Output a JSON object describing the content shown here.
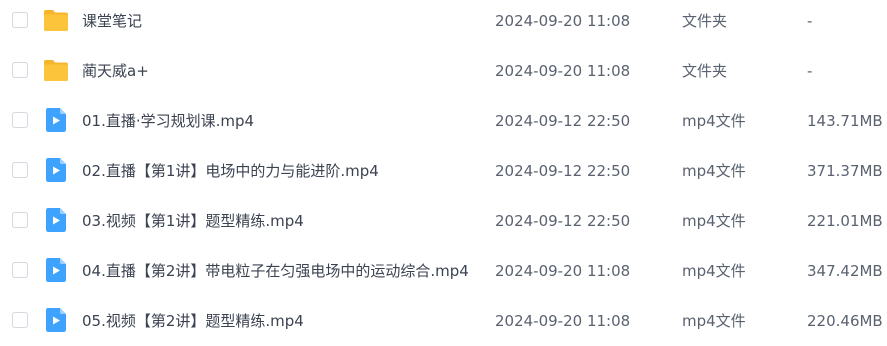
{
  "files": [
    {
      "name": "课堂笔记",
      "modified": "2024-09-20 11:08",
      "type": "文件夹",
      "size": "-",
      "icon": "folder-icon"
    },
    {
      "name": "蔺天威a+",
      "modified": "2024-09-20 11:08",
      "type": "文件夹",
      "size": "-",
      "icon": "folder-icon"
    },
    {
      "name": "01.直播·学习规划课.mp4",
      "modified": "2024-09-12 22:50",
      "type": "mp4文件",
      "size": "143.71MB",
      "icon": "video-file-icon"
    },
    {
      "name": "02.直播【第1讲】电场中的力与能进阶.mp4",
      "modified": "2024-09-12 22:50",
      "type": "mp4文件",
      "size": "371.37MB",
      "icon": "video-file-icon"
    },
    {
      "name": "03.视频【第1讲】题型精练.mp4",
      "modified": "2024-09-12 22:50",
      "type": "mp4文件",
      "size": "221.01MB",
      "icon": "video-file-icon"
    },
    {
      "name": "04.直播【第2讲】带电粒子在匀强电场中的运动综合.mp4",
      "modified": "2024-09-20 11:08",
      "type": "mp4文件",
      "size": "347.42MB",
      "icon": "video-file-icon"
    },
    {
      "name": "05.视频【第2讲】题型精练.mp4",
      "modified": "2024-09-20 11:08",
      "type": "mp4文件",
      "size": "220.46MB",
      "icon": "video-file-icon"
    }
  ],
  "colors": {
    "folder": "#fcc43a",
    "video": "#3ea3ff"
  }
}
